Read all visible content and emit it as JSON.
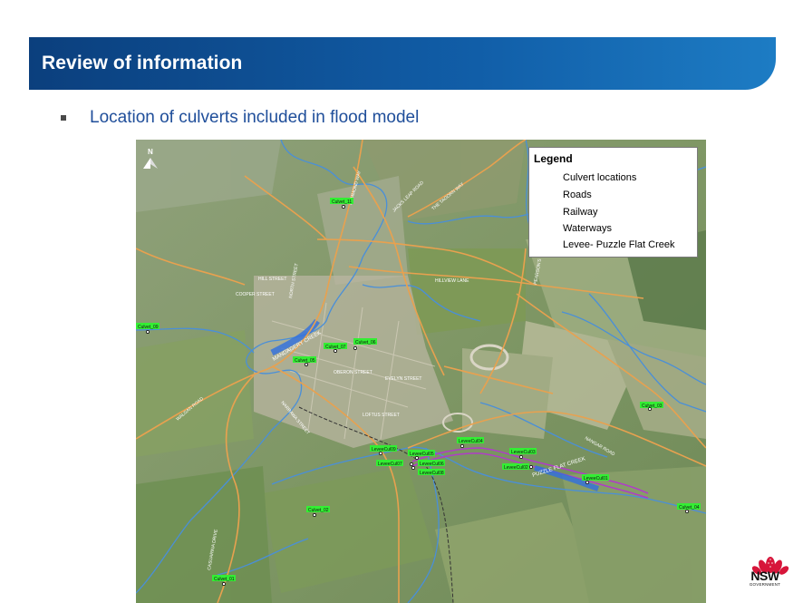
{
  "slide": {
    "title": "Review of information",
    "bullet": "Location of culverts included in flood model"
  },
  "map": {
    "north_label": "N",
    "legend": {
      "title": "Legend",
      "items": [
        {
          "label": "Culvert locations",
          "symbol": "point",
          "color": "#000000"
        },
        {
          "label": "Roads",
          "symbol": "line",
          "color": "#e8a14f"
        },
        {
          "label": "Railway",
          "symbol": "dash-line",
          "color": "#333333"
        },
        {
          "label": "Waterways",
          "symbol": "line",
          "color": "#4a8fd8"
        },
        {
          "label": "Levee- Puzzle Flat Creek",
          "symbol": "line",
          "color": "#b03cc8"
        }
      ]
    },
    "road_labels": [
      "HILL STREET",
      "COOPER STREET",
      "NORTH STREET",
      "HAMMOND WAY",
      "JACKS LEAP ROAD",
      "THE TAOORN WAY",
      "HILLVIEW LANE",
      "PEARSON'S STREET",
      "OBERON STREET",
      "EVELYN STREET",
      "LOFTUS STREET",
      "NARRAWA STREET",
      "WALGAN ROAD",
      "NANGAR ROAD",
      "CASUARINA DRIVE"
    ],
    "waterway_labels": [
      "MANDAGERY CREEK",
      "PUZZLE FLAT CREEK"
    ],
    "culverts": [
      "Culvet_11",
      "Culvet_09",
      "Culvet_07",
      "Culvet_06",
      "Culvet_05",
      "Culvet_03",
      "Culvet_04",
      "Culvet_02",
      "Culvet_01",
      "LeveeCul09",
      "LeveeCul05",
      "LeveeCul07",
      "LeveeCul06",
      "LeveeCul08",
      "LeveeCul04",
      "LeveeCul03",
      "LeveeCul02",
      "LeveeCul01"
    ],
    "colors": {
      "roads": "#e8a14f",
      "waterways": "#4a8fd8",
      "levee": "#b03cc8",
      "culvert_label_bg": "#33ee33",
      "creek_highlight": "#2f6fe0"
    }
  },
  "logo": {
    "text": "NSW",
    "subtext": "GOVERNMENT"
  }
}
